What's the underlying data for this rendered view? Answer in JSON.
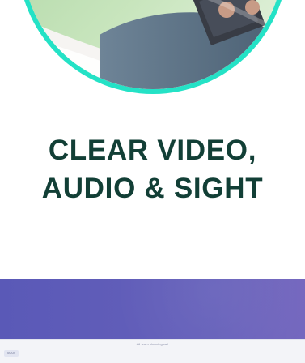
{
  "headline": {
    "line1": "CLEAR VIDEO,",
    "line2": "AUDIO & SIGHT"
  },
  "preview": {
    "window_title": "All team planning call",
    "timer": "00:04"
  },
  "colors": {
    "accent_ring": "#24e2c6",
    "headline_text": "#123f36",
    "preview_purple": "#5e5ab7",
    "chrome_bg": "#f3f4f8"
  }
}
